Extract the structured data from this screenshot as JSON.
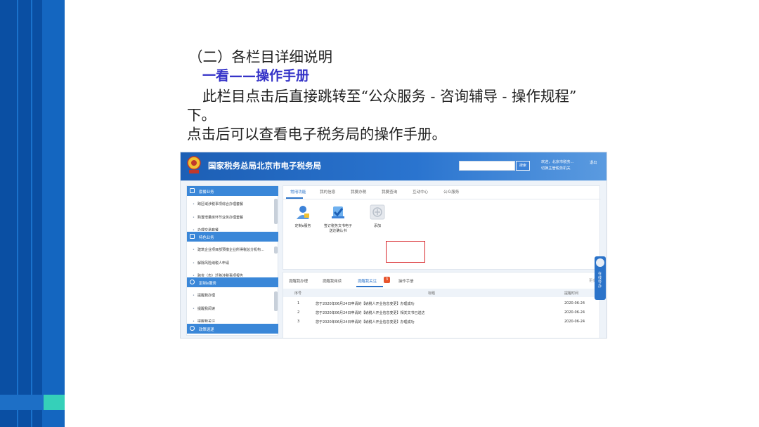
{
  "slide": {
    "heading": "（二）各栏目详细说明",
    "subheading": "一看——操作手册",
    "para_line1": "此栏目点击后直接跳转至“公众服务 - 咨询辅导 - 操作规程”",
    "para_line2": "下。",
    "para_line3": "点击后可以查看电子税务局的操作手册。"
  },
  "colors": {
    "band_dark": "#0a4fa3",
    "band_light": "#1466c0",
    "accent_teal": "#35d0b9",
    "subheading": "#3533c8",
    "header_blue": "#2a74cf",
    "highlight_red": "#d8262b"
  },
  "screenshot": {
    "title": "国家税务总局北京市电子税务局",
    "search_button": "搜索",
    "welcome_line1": "欢迎，北京市税务...",
    "welcome_line2": "切换主管税务机关",
    "logout": "退出",
    "menu": {
      "sections": [
        {
          "label": "套餐业务",
          "icon": "package-icon"
        },
        {
          "label": "特色业务",
          "icon": "grid-icon"
        },
        {
          "label": "定制e服务",
          "icon": "user-icon"
        },
        {
          "label": "政策速递",
          "icon": "user-icon"
        }
      ],
      "items": [
        "跨区域涉税事项综合办理套餐",
        "购置增量房环节业务办理套餐",
        "办理交易套餐",
        "建筑企业项目部预缴企业所得税总分机构...",
        "解除风险纳税人申请",
        "跨省（市）迁移涉税事项报告",
        "提醒我办理",
        "提醒我阅读",
        "提醒我关注"
      ]
    },
    "tabs": [
      "常用功能",
      "我的信息",
      "我要办税",
      "我要查询",
      "互动中心",
      "公众服务"
    ],
    "functions": [
      {
        "label": "定制e服务",
        "icon": "person-service-icon"
      },
      {
        "label": "签订税务文书电子送达确认书",
        "icon": "sign-document-icon"
      },
      {
        "label": "添加",
        "icon": "add-icon"
      }
    ],
    "bottom_tabs": [
      "提醒我办理",
      "提醒我阅读",
      "提醒我关注",
      "操作手册"
    ],
    "badge_count": "3",
    "more_label": "更多",
    "table": {
      "headers": [
        "序号",
        "标题",
        "提醒时间"
      ],
      "rows": [
        {
          "no": "1",
          "title": "您于2020年06月24日申请的【纳税人开业信息变更】办理成功",
          "date": "2020-06-24"
        },
        {
          "no": "2",
          "title": "您于2020年06月24日申请的【纳税人开业信息变更】相关文书已送达",
          "date": "2020-06-24"
        },
        {
          "no": "3",
          "title": "您于2020年06月24日申请的【纳税人开业信息变更】办理成功",
          "date": "2020-06-24"
        }
      ]
    },
    "float_tool_label": "在线导办"
  }
}
